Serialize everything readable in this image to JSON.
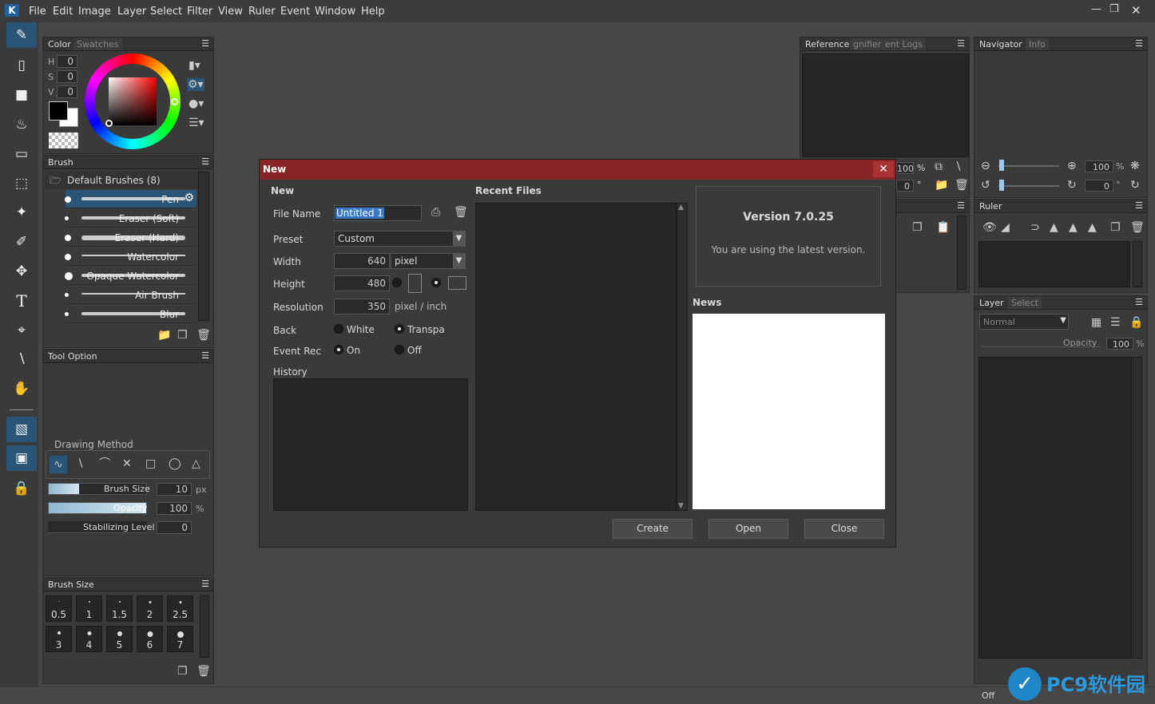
{
  "menubar": {
    "items": [
      "File",
      "Edit",
      "Image",
      "Layer",
      "Select",
      "Filter",
      "View",
      "Ruler",
      "Event",
      "Window",
      "Help"
    ],
    "logo": "K"
  },
  "toolbar": {
    "tools": [
      "pen-icon",
      "eraser-icon",
      "square-fill-icon",
      "bucket-icon",
      "gradient-icon",
      "marquee-icon",
      "magic-wand-icon",
      "select-pen-icon",
      "move-icon",
      "text-icon",
      "crop-icon",
      "eyedropper-icon",
      "hand-icon",
      "perspective-icon",
      "stamp-icon",
      "lock-icon"
    ],
    "text_tool": "T"
  },
  "color_panel": {
    "tabs": [
      "Color",
      "Swatches"
    ],
    "h_label": "H",
    "s_label": "S",
    "v_label": "V",
    "h": "0",
    "s": "0",
    "v": "0"
  },
  "brush_panel": {
    "title": "Brush",
    "group": "Default Brushes (8)",
    "items": [
      "Pen",
      "Eraser (Soft)",
      "Eraser (Hard)",
      "Watercolor",
      "Opaque Watercolor",
      "Air Brush",
      "Blur"
    ]
  },
  "tool_option": {
    "title": "Tool Option",
    "drawing_method": "Drawing Method",
    "brush_size_label": "Brush Size",
    "brush_size": "10",
    "brush_size_unit": "px",
    "opacity_label": "Opacity",
    "opacity": "100",
    "opacity_unit": "%",
    "stabilizing_label": "Stabilizing Level",
    "stabilizing": "0"
  },
  "brush_size_panel": {
    "title": "Brush Size",
    "sizes": [
      "0.5",
      "1",
      "1.5",
      "2",
      "2.5",
      "3",
      "4",
      "5",
      "6",
      "7"
    ]
  },
  "reference_panel": {
    "tabs": [
      "Reference",
      "gnifier",
      "ent Logs"
    ],
    "zoom": "100",
    "zoom_unit": "%",
    "angle": "0",
    "angle_unit": "°"
  },
  "navigator_panel": {
    "tabs": [
      "Navigator",
      "Info"
    ],
    "zoom": "100",
    "zoom_unit": "%",
    "angle": "0",
    "angle_unit": "°"
  },
  "ruler_panel": {
    "title": "Ruler"
  },
  "layer_panel": {
    "tabs": [
      "Layer",
      "Select"
    ],
    "blend_mode": "Normal",
    "opacity_label": "Opacity",
    "opacity": "100",
    "opacity_unit": "%"
  },
  "dialog": {
    "title": "New",
    "section_new": "New",
    "section_recent": "Recent Files",
    "file_name_label": "File Name",
    "file_name": "Untitled 1",
    "preset_label": "Preset",
    "preset": "Custom",
    "width_label": "Width",
    "width": "640",
    "unit": "pixel",
    "height_label": "Height",
    "height": "480",
    "resolution_label": "Resolution",
    "resolution": "350",
    "resolution_unit": "pixel / inch",
    "back_label": "Back",
    "back_white": "White",
    "back_transparent": "Transpa",
    "event_rec_label": "Event Rec",
    "event_on": "On",
    "event_off": "Off",
    "history_label": "History",
    "version": "Version 7.0.25",
    "version_msg": "You are using the latest version.",
    "news_label": "News",
    "create": "Create",
    "open": "Open",
    "close": "Close"
  },
  "statusbar": {
    "off": "Off"
  },
  "watermark": "PC9软件园",
  "colors": {
    "accent": "#2a5576",
    "dialog_title": "#8b2424",
    "selection": "#3a78c8"
  }
}
